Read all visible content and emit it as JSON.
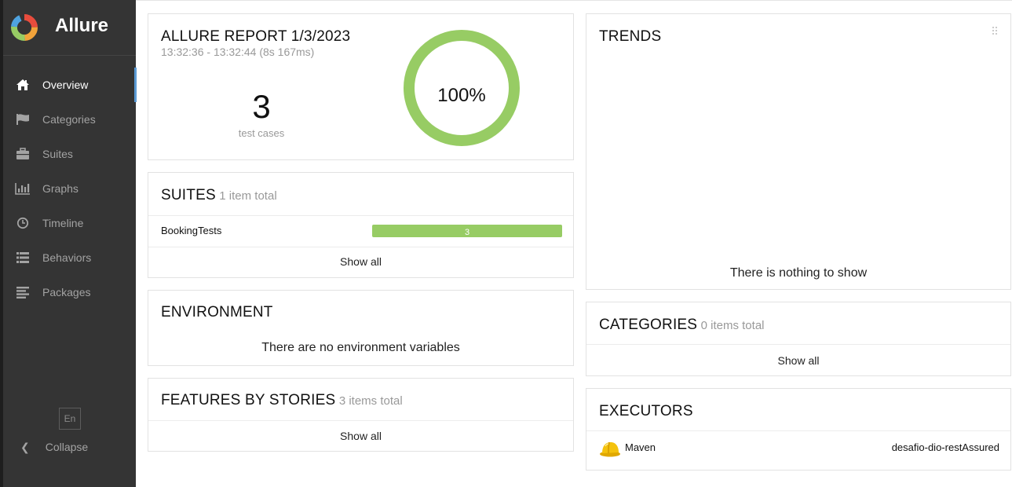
{
  "brand": {
    "name": "Allure"
  },
  "sidebar": {
    "items": [
      {
        "label": "Overview",
        "icon": "home-icon",
        "active": true
      },
      {
        "label": "Categories",
        "icon": "flag-icon",
        "active": false
      },
      {
        "label": "Suites",
        "icon": "briefcase-icon",
        "active": false
      },
      {
        "label": "Graphs",
        "icon": "bar-chart-icon",
        "active": false
      },
      {
        "label": "Timeline",
        "icon": "clock-icon",
        "active": false
      },
      {
        "label": "Behaviors",
        "icon": "list-icon",
        "active": false
      },
      {
        "label": "Packages",
        "icon": "align-left-icon",
        "active": false
      }
    ],
    "lang": "En",
    "collapse_label": "Collapse"
  },
  "summary": {
    "title": "ALLURE REPORT 1/3/2023",
    "time": "13:32:36 - 13:32:44 (8s 167ms)",
    "count": "3",
    "count_label": "test cases",
    "percent": "100%",
    "pass_fraction": 1.0,
    "color": "#97cc64"
  },
  "suites": {
    "title": "SUITES",
    "subtitle": "1 item total",
    "rows": [
      {
        "name": "BookingTests",
        "count": "3",
        "passed": 3,
        "total": 3
      }
    ],
    "show_all": "Show all",
    "bar_color": "#97cc64"
  },
  "environment": {
    "title": "ENVIRONMENT",
    "empty": "There are no environment variables"
  },
  "features": {
    "title": "FEATURES BY STORIES",
    "subtitle": "3 items total",
    "show_all": "Show all"
  },
  "trend": {
    "title": "TRENDS",
    "empty": "There is nothing to show"
  },
  "categories": {
    "title": "CATEGORIES",
    "subtitle": "0 items total",
    "show_all": "Show all"
  },
  "executors": {
    "title": "EXECUTORS",
    "rows": [
      {
        "name": "Maven",
        "build": "desafio-dio-restAssured",
        "icon": "hard-hat-icon"
      }
    ]
  }
}
